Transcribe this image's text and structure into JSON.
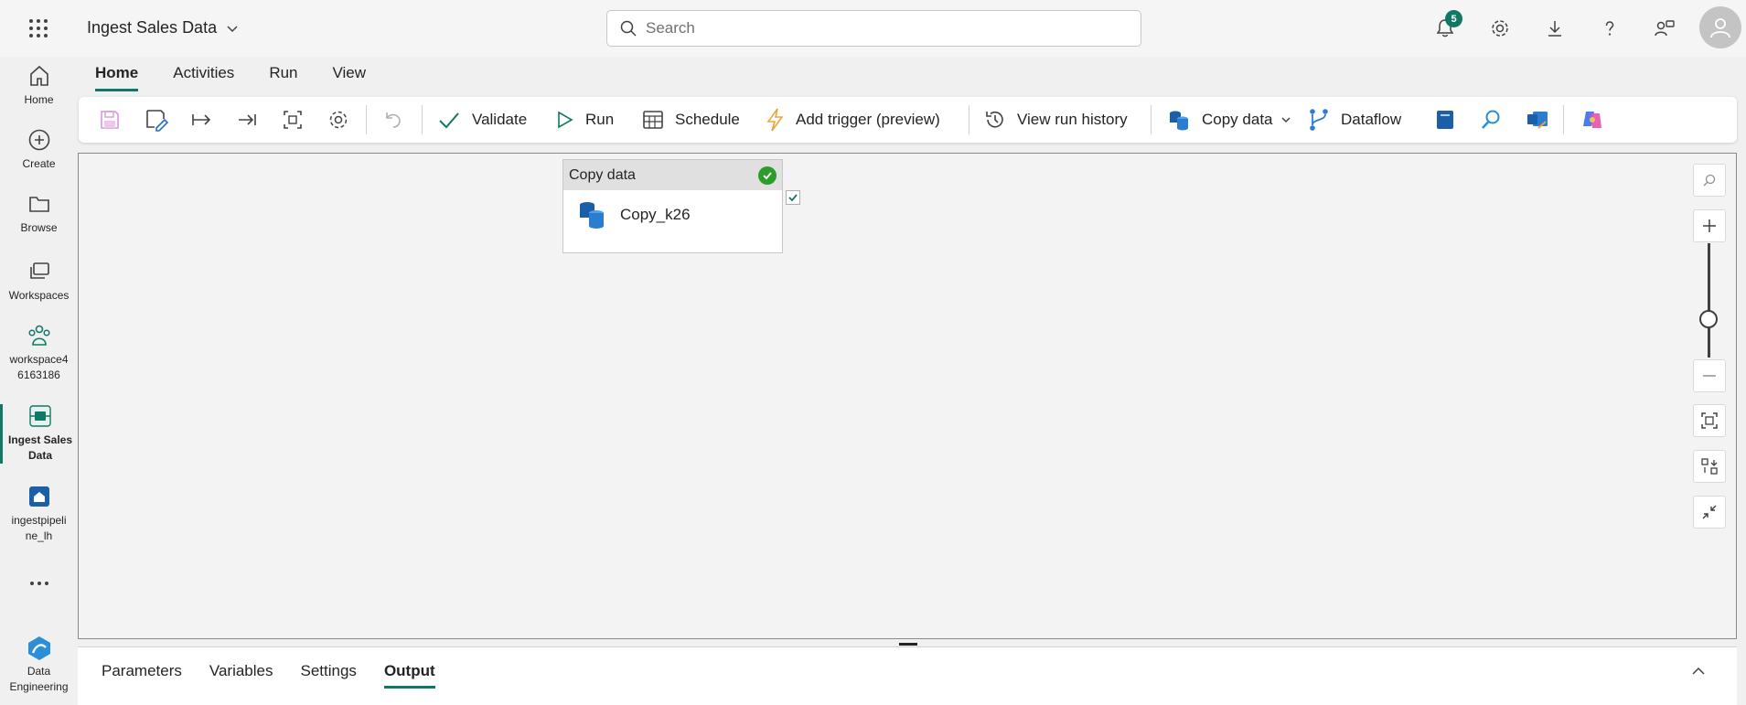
{
  "header": {
    "app_title": "Ingest Sales Data",
    "search_placeholder": "Search",
    "notifications_count": "5"
  },
  "rail": {
    "items": [
      {
        "label": "Home"
      },
      {
        "label": "Create"
      },
      {
        "label": "Browse"
      },
      {
        "label": "Workspaces"
      },
      {
        "label": "workspace4\n6163186"
      },
      {
        "label": "Ingest Sales\nData"
      },
      {
        "label": "ingestpipeli\nne_lh"
      },
      {
        "label": "Data\nEngineering"
      }
    ]
  },
  "ribbon": {
    "tabs": [
      "Home",
      "Activities",
      "Run",
      "View"
    ],
    "active_tab": "Home",
    "validate_label": "Validate",
    "run_label": "Run",
    "schedule_label": "Schedule",
    "add_trigger_label": "Add trigger (preview)",
    "view_run_history_label": "View run history",
    "copy_data_label": "Copy data",
    "dataflow_label": "Dataflow"
  },
  "canvas": {
    "activity": {
      "type_label": "Copy data",
      "name": "Copy_k26",
      "status": "succeeded"
    }
  },
  "bottom_panel": {
    "tabs": [
      "Parameters",
      "Variables",
      "Settings",
      "Output"
    ],
    "active_tab": "Output"
  },
  "colors": {
    "accent": "#117865",
    "success": "#2c9d2c"
  }
}
